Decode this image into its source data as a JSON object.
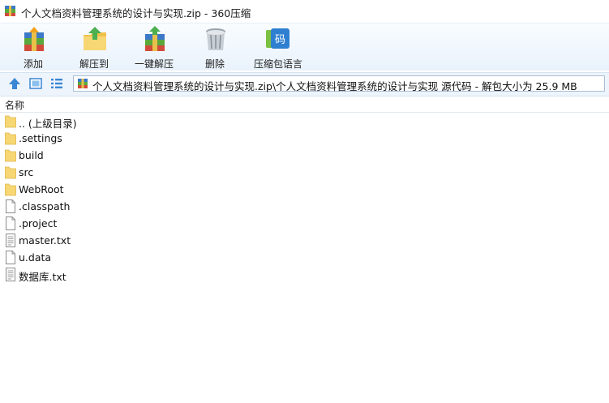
{
  "window": {
    "title": "个人文档资料管理系统的设计与实现.zip - 360压缩"
  },
  "toolbar": {
    "add": "添加",
    "extract_to": "解压到",
    "one_click_extract": "一键解压",
    "delete": "删除",
    "archive_language": "压缩包语言",
    "language_icon_text": "码"
  },
  "address": {
    "path": "个人文档资料管理系统的设计与实现.zip\\个人文档资料管理系统的设计与实现 源代码 - 解包大小为 25.9 MB"
  },
  "list": {
    "column_name": "名称",
    "items": [
      {
        "name": ".. (上级目录)",
        "type": "folder"
      },
      {
        "name": ".settings",
        "type": "folder"
      },
      {
        "name": "build",
        "type": "folder"
      },
      {
        "name": "src",
        "type": "folder"
      },
      {
        "name": "WebRoot",
        "type": "folder"
      },
      {
        "name": ".classpath",
        "type": "file"
      },
      {
        "name": ".project",
        "type": "file"
      },
      {
        "name": "master.txt",
        "type": "text"
      },
      {
        "name": "u.data",
        "type": "file"
      },
      {
        "name": "数据库.txt",
        "type": "text"
      }
    ]
  },
  "colors": {
    "folder": "#f7d774",
    "accent": "#3a86d4",
    "toolbar_bg": "#eef5fc"
  },
  "icons": {
    "app": "archive-icon",
    "add": "archive-add-icon",
    "extract_to": "archive-extract-icon",
    "one_click_extract": "archive-quick-extract-icon",
    "delete": "trash-bin-icon",
    "archive_language": "language-code-icon",
    "up": "up-arrow-icon",
    "view_large": "large-icon-view-icon",
    "view_list": "list-view-icon"
  }
}
